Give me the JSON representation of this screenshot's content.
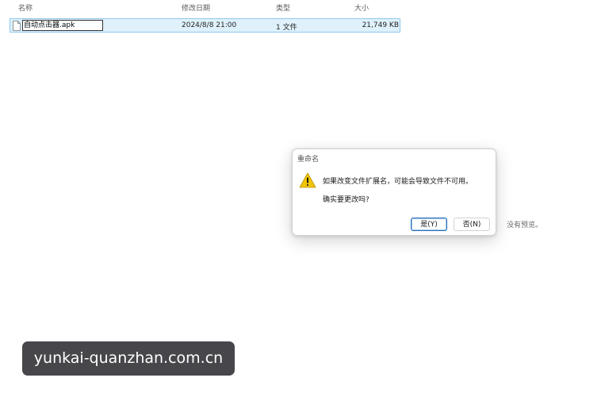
{
  "columns": {
    "name": "名称",
    "date": "修改日期",
    "type": "类型",
    "size": "大小"
  },
  "file": {
    "icon": "file-icon",
    "name": "自动点击器.apk",
    "date": "2024/8/8 21:00",
    "type": "1 文件",
    "size": "21,749 KB"
  },
  "preview": {
    "message": "没有预览。"
  },
  "dialog": {
    "title": "重命名",
    "icon": "warning-icon",
    "message": "如果改变文件扩展名，可能会导致文件不可用。",
    "question": "确实要更改吗?",
    "yes_label": "是(Y)",
    "no_label": "否(N)"
  },
  "watermark": {
    "text": "yunkai-quanzhan.com.cn"
  },
  "colors": {
    "selection_bg": "#dff1fb",
    "selection_border": "#8fc9ee",
    "warning_yellow": "#f2c500",
    "primary_button_border": "#2c6fb5"
  }
}
